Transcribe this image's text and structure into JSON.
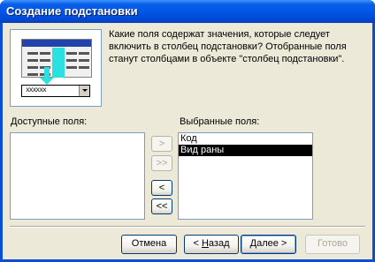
{
  "window": {
    "title": "Создание подстановки"
  },
  "illustration": {
    "combo_text": "xxxxxx"
  },
  "description": "Какие поля содержат значения, которые следует включить в столбец подстановки? Отобранные поля станут столбцами в объекте \"столбец подстановки\".",
  "available_fields": {
    "label": "Доступные поля:",
    "items": []
  },
  "selected_fields": {
    "label": "Выбранные поля:",
    "items": [
      "Код",
      "Вид раны"
    ],
    "selected_index": 1
  },
  "move_buttons": {
    "add_one": ">",
    "add_all": ">>",
    "remove_one": "<",
    "remove_all": "<<"
  },
  "buttons": {
    "cancel": "Отмена",
    "back_prefix": "< ",
    "back_hotkey": "Н",
    "back_rest": "азад",
    "next_hotkey": "Д",
    "next_rest": "алее >",
    "finish": "Готово"
  },
  "colors": {
    "titlebar": "#0055e5",
    "dialog_bg": "#ece9d8",
    "selection": "#000000",
    "accent_cyan": "#2de0e0"
  }
}
